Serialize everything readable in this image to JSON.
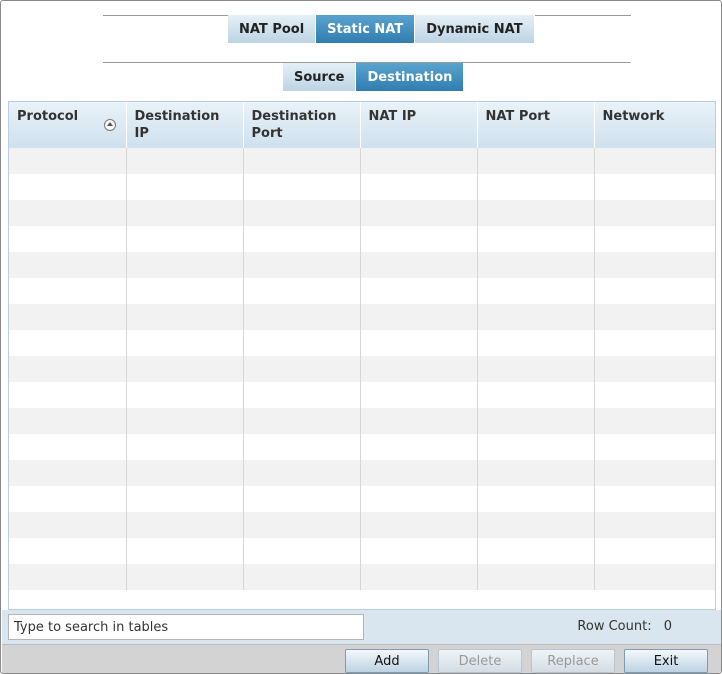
{
  "tabs": {
    "primary": [
      {
        "label": "NAT Pool",
        "active": false
      },
      {
        "label": "Static NAT",
        "active": true
      },
      {
        "label": "Dynamic NAT",
        "active": false
      }
    ],
    "secondary": [
      {
        "label": "Source",
        "active": false
      },
      {
        "label": "Destination",
        "active": true
      }
    ]
  },
  "table": {
    "columns": [
      "Protocol",
      "Destination IP",
      "Destination Port",
      "NAT IP",
      "NAT Port",
      "Network"
    ],
    "sort_icon": "sort-ascending-icon",
    "rows": []
  },
  "search": {
    "placeholder": "Type to search in tables"
  },
  "row_count": {
    "label": "Row  Count:",
    "value": "0"
  },
  "buttons": {
    "add": "Add",
    "delete": "Delete",
    "replace": "Replace",
    "exit": "Exit"
  },
  "colors": {
    "tab_active": "#3a88bb",
    "tab_inactive": "#cfe0ec",
    "header_bg": "#dbe9f3",
    "row_stripe": "#f2f2f2"
  }
}
